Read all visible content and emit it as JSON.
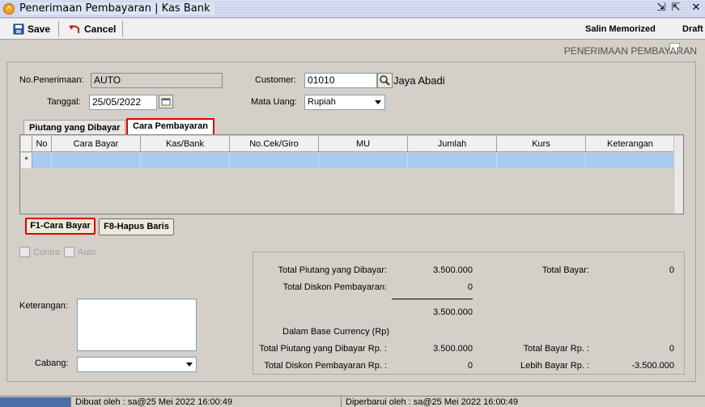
{
  "window": {
    "title": "Penerimaan Pembayaran | Kas Bank",
    "controls": [
      "⇲",
      "⇱",
      "✕"
    ]
  },
  "toolbar": {
    "save_label": "Save",
    "cancel_label": "Cancel",
    "salin_memorized_label": "Salin Memorized",
    "draft_label": "Draft"
  },
  "header": {
    "section_title": "PENERIMAAN PEMBAYARAN"
  },
  "form": {
    "no_penerimaan_label": "No.Penerimaan:",
    "no_penerimaan_value": "AUTO",
    "tanggal_label": "Tanggal:",
    "tanggal_value": "25/05/2022",
    "customer_label": "Customer:",
    "customer_value": "01010",
    "customer_name": "Jaya Abadi",
    "mata_uang_label": "Mata Uang:",
    "mata_uang_value": "Rupiah"
  },
  "tabs": [
    {
      "label": "Piutang yang Dibayar",
      "active": false
    },
    {
      "label": "Cara Pembayaran",
      "active": true
    }
  ],
  "grid": {
    "columns": [
      "No",
      "Cara Bayar",
      "Kas/Bank",
      "No.Cek/Giro",
      "MU",
      "Jumlah",
      "Kurs",
      "Keterangan"
    ],
    "new_row_marker": "*"
  },
  "grid_buttons": {
    "cara_bayar": "F1-Cara Bayar",
    "hapus_baris": "F8-Hapus Baris"
  },
  "options": {
    "contra_label": "Contra",
    "auto_label": "Auto"
  },
  "bottom_form": {
    "keterangan_label": "Keterangan:",
    "cabang_label": "Cabang:"
  },
  "summary": {
    "total_piutang_label": "Total Piutang yang Dibayar:",
    "total_piutang_value": "3.500.000",
    "total_diskon_label": "Total Diskon Pembayaran:",
    "total_diskon_value": "0",
    "subtotal_value": "3.500.000",
    "total_bayar_label": "Total Bayar:",
    "total_bayar_value": "0",
    "base_currency_label": "Dalam Base Currency (Rp)",
    "total_piutang_rp_label": "Total Piutang yang Dibayar Rp. :",
    "total_piutang_rp_value": "3.500.000",
    "total_diskon_rp_label": "Total Diskon Pembayaran Rp. :",
    "total_diskon_rp_value": "0",
    "total_bayar_rp_label": "Total Bayar Rp. :",
    "total_bayar_rp_value": "0",
    "lebih_bayar_rp_label": "Lebih Bayar Rp. :",
    "lebih_bayar_rp_value": "-3.500.000"
  },
  "status": {
    "dibuat_oleh": "Dibuat oleh : sa@25 Mei 2022  16:00:49",
    "diperbarui_oleh": "Diperbarui oleh : sa@25 Mei 2022  16:00:49"
  },
  "colors": {
    "highlight_border": "#e00000",
    "selected_row": "#a8ccf0",
    "panel_bg": "#d4d0c8"
  }
}
